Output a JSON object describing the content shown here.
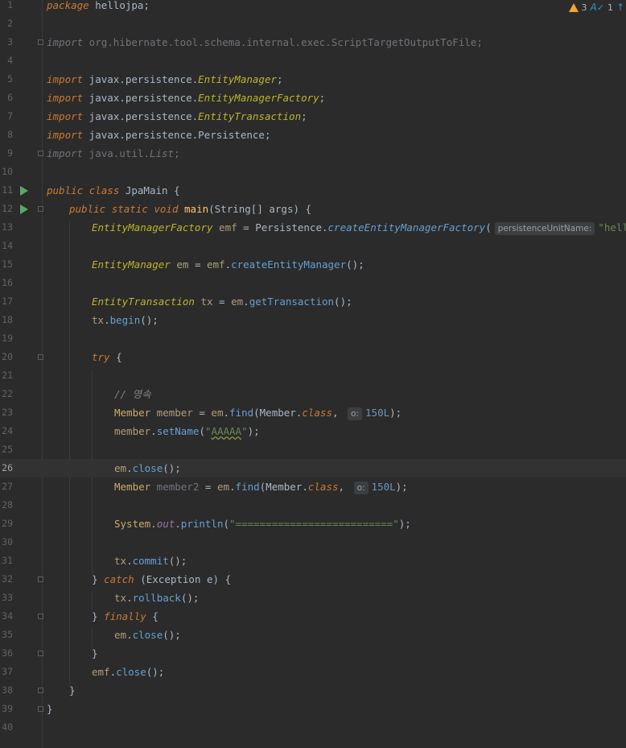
{
  "editor": {
    "current_line": "26",
    "indicators": {
      "warnings": "3",
      "typos": "1"
    },
    "lines": [
      {
        "n": "1"
      },
      {
        "n": "2"
      },
      {
        "n": "3"
      },
      {
        "n": "4"
      },
      {
        "n": "5"
      },
      {
        "n": "6"
      },
      {
        "n": "7"
      },
      {
        "n": "8"
      },
      {
        "n": "9"
      },
      {
        "n": "10"
      },
      {
        "n": "11"
      },
      {
        "n": "12"
      },
      {
        "n": "13"
      },
      {
        "n": "14"
      },
      {
        "n": "15"
      },
      {
        "n": "16"
      },
      {
        "n": "17"
      },
      {
        "n": "18"
      },
      {
        "n": "19"
      },
      {
        "n": "20"
      },
      {
        "n": "21"
      },
      {
        "n": "22"
      },
      {
        "n": "23"
      },
      {
        "n": "24"
      },
      {
        "n": "25"
      },
      {
        "n": "26"
      },
      {
        "n": "27"
      },
      {
        "n": "28"
      },
      {
        "n": "29"
      },
      {
        "n": "30"
      },
      {
        "n": "31"
      },
      {
        "n": "32"
      },
      {
        "n": "33"
      },
      {
        "n": "34"
      },
      {
        "n": "35"
      },
      {
        "n": "36"
      },
      {
        "n": "37"
      },
      {
        "n": "38"
      },
      {
        "n": "39"
      },
      {
        "n": "40"
      }
    ],
    "code": {
      "l1_kw": "package",
      "l1_name": " hellojpa;",
      "l3_kw": "import",
      "l3_path": " org.hibernate.tool.schema.internal.exec.ScriptTargetOutputToFile;",
      "l5_kw": "import",
      "l5_pkg": " javax.persistence.",
      "l5_cls": "EntityManager",
      "l6_kw": "import",
      "l6_pkg": " javax.persistence.",
      "l6_cls": "EntityManagerFactory",
      "l7_kw": "import",
      "l7_pkg": " javax.persistence.",
      "l7_cls": "EntityTransaction",
      "l8_kw": "import",
      "l8_pkg": " javax.persistence.",
      "l8_cls": "Persistence",
      "l9_kw": "import",
      "l9_pkg": " java.util.",
      "l9_cls": "List",
      "l11_public": "public",
      "l11_class": "class",
      "l11_name": " JpaMain {",
      "l12_public": "public",
      "l12_static": "static",
      "l12_void": "void",
      "l12_main": "main",
      "l12_rest": "(String[] args) {",
      "l13_type": "EntityManagerFactory",
      "l13_var": " emf",
      "l13_eq": " = Persistence.",
      "l13_call": "createEntityManagerFactory",
      "l13_paren": "(",
      "l13_hint": "persistenceUnitName:",
      "l13_str": "\"hello\"",
      "l13_end": ");",
      "l15_type": "EntityManager",
      "l15_var": " em",
      "l15_eq": " = ",
      "l15_obj": "emf",
      "l15_dot": ".",
      "l15_call": "createEntityManager",
      "l15_end": "();",
      "l17_type": "EntityTransaction",
      "l17_var": " tx",
      "l17_eq": " = ",
      "l17_obj": "em",
      "l17_dot": ".",
      "l17_call": "getTransaction",
      "l17_end": "();",
      "l18_obj": "tx",
      "l18_dot": ".",
      "l18_call": "begin",
      "l18_end": "();",
      "l20_kw": "try",
      "l20_brace": " {",
      "l22_comment": "// 영속",
      "l23_type": "Member",
      "l23_var": " member",
      "l23_eq": " = ",
      "l23_obj": "em",
      "l23_dot": ".",
      "l23_call": "find",
      "l23_arg": "(Member.",
      "l23_class": "class",
      "l23_comma": ", ",
      "l23_hint": "o:",
      "l23_num": "150L",
      "l23_end": ");",
      "l24_obj": "member",
      "l24_dot": ".",
      "l24_call": "setName",
      "l24_open": "(",
      "l24_str1": "\"",
      "l24_str2": "AAAAA",
      "l24_str3": "\"",
      "l24_end": ");",
      "l26_obj": "em",
      "l26_dot": ".",
      "l26_call": "close",
      "l26_end": "();",
      "l27_type": "Member",
      "l27_var": " member2",
      "l27_eq": " = ",
      "l27_obj": "em",
      "l27_dot": ".",
      "l27_call": "find",
      "l27_arg": "(Member.",
      "l27_class": "class",
      "l27_comma": ", ",
      "l27_hint": "o:",
      "l27_num": "150L",
      "l27_end": ");",
      "l29_sys": "System.",
      "l29_out": "out",
      "l29_dot": ".",
      "l29_call": "println",
      "l29_open": "(",
      "l29_str": "\"==========================\"",
      "l29_end": ");",
      "l31_obj": "tx",
      "l31_dot": ".",
      "l31_call": "commit",
      "l31_end": "();",
      "l32_close": "} ",
      "l32_kw": "catch",
      "l32_rest": " (Exception e) {",
      "l33_obj": "tx",
      "l33_dot": ".",
      "l33_call": "rollback",
      "l33_end": "();",
      "l34_close": "} ",
      "l34_kw": "finally",
      "l34_rest": " {",
      "l35_obj": "em",
      "l35_dot": ".",
      "l35_call": "close",
      "l35_end": "();",
      "l36_close": "}",
      "l37_obj": "emf",
      "l37_dot": ".",
      "l37_call": "close",
      "l37_end": "();",
      "l38_close": "}",
      "l39_close": "}"
    }
  }
}
